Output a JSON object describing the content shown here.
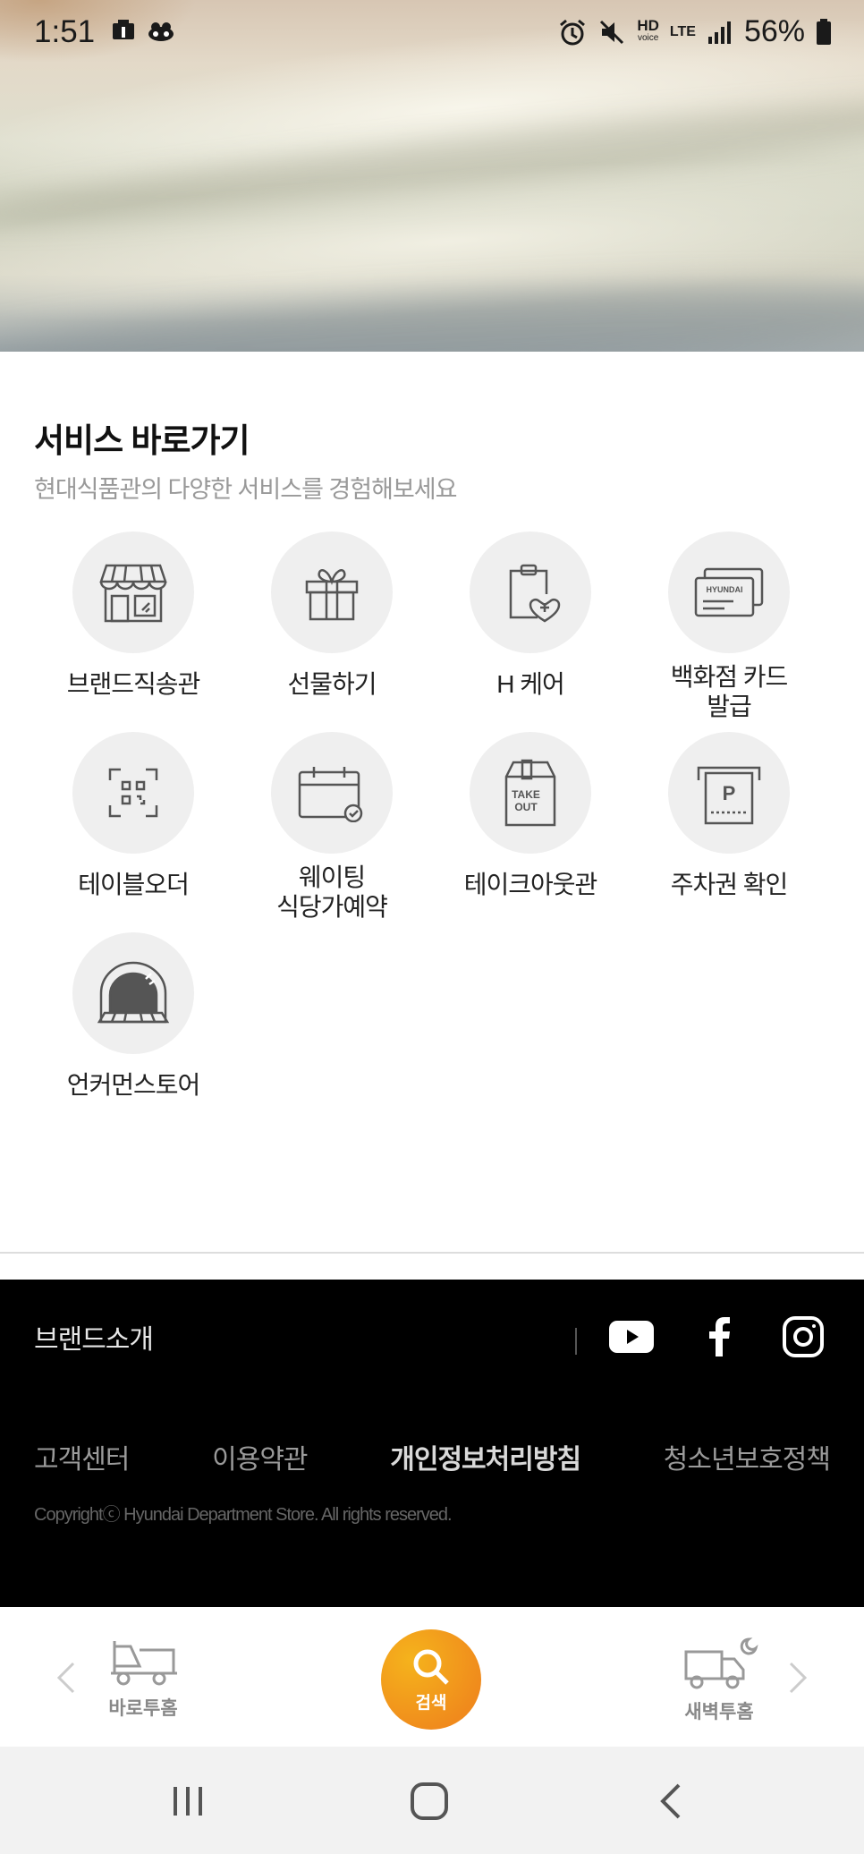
{
  "status_bar": {
    "time": "1:51",
    "battery_percent": "56%",
    "network_label": "LTE",
    "hd_label": "HD"
  },
  "service": {
    "title": "서비스 바로가기",
    "subtitle": "현대식품관의 다양한 서비스를 경험해보세요",
    "items": [
      {
        "label": "브랜드직송관",
        "icon": "storefront-icon"
      },
      {
        "label": "선물하기",
        "icon": "gift-icon"
      },
      {
        "label": "H 케어",
        "icon": "clipboard-heart-icon"
      },
      {
        "label": "백화점 카드\n발급",
        "icon": "card-icon",
        "card_text": "HYUNDAI"
      },
      {
        "label": "테이블오더",
        "icon": "qr-scan-icon"
      },
      {
        "label": "웨이팅\n식당가예약",
        "icon": "calendar-check-icon"
      },
      {
        "label": "테이크아웃관",
        "icon": "takeout-bag-icon",
        "bag_text_1": "TAKE",
        "bag_text_2": "OUT"
      },
      {
        "label": "주차권 확인",
        "icon": "parking-ticket-icon",
        "ticket_text": "P"
      },
      {
        "label": "언커먼스토어",
        "icon": "oven-icon"
      }
    ]
  },
  "footer": {
    "brand_intro": "브랜드소개",
    "links": [
      "고객센터",
      "이용약관",
      "개인정보처리방침",
      "청소년보호정책"
    ],
    "copyright": "Copyrightⓒ Hyundai Department Store. All rights reserved."
  },
  "app_nav": {
    "left_label": "바로투홈",
    "search_label": "검색",
    "right_label": "새벽투홈"
  }
}
